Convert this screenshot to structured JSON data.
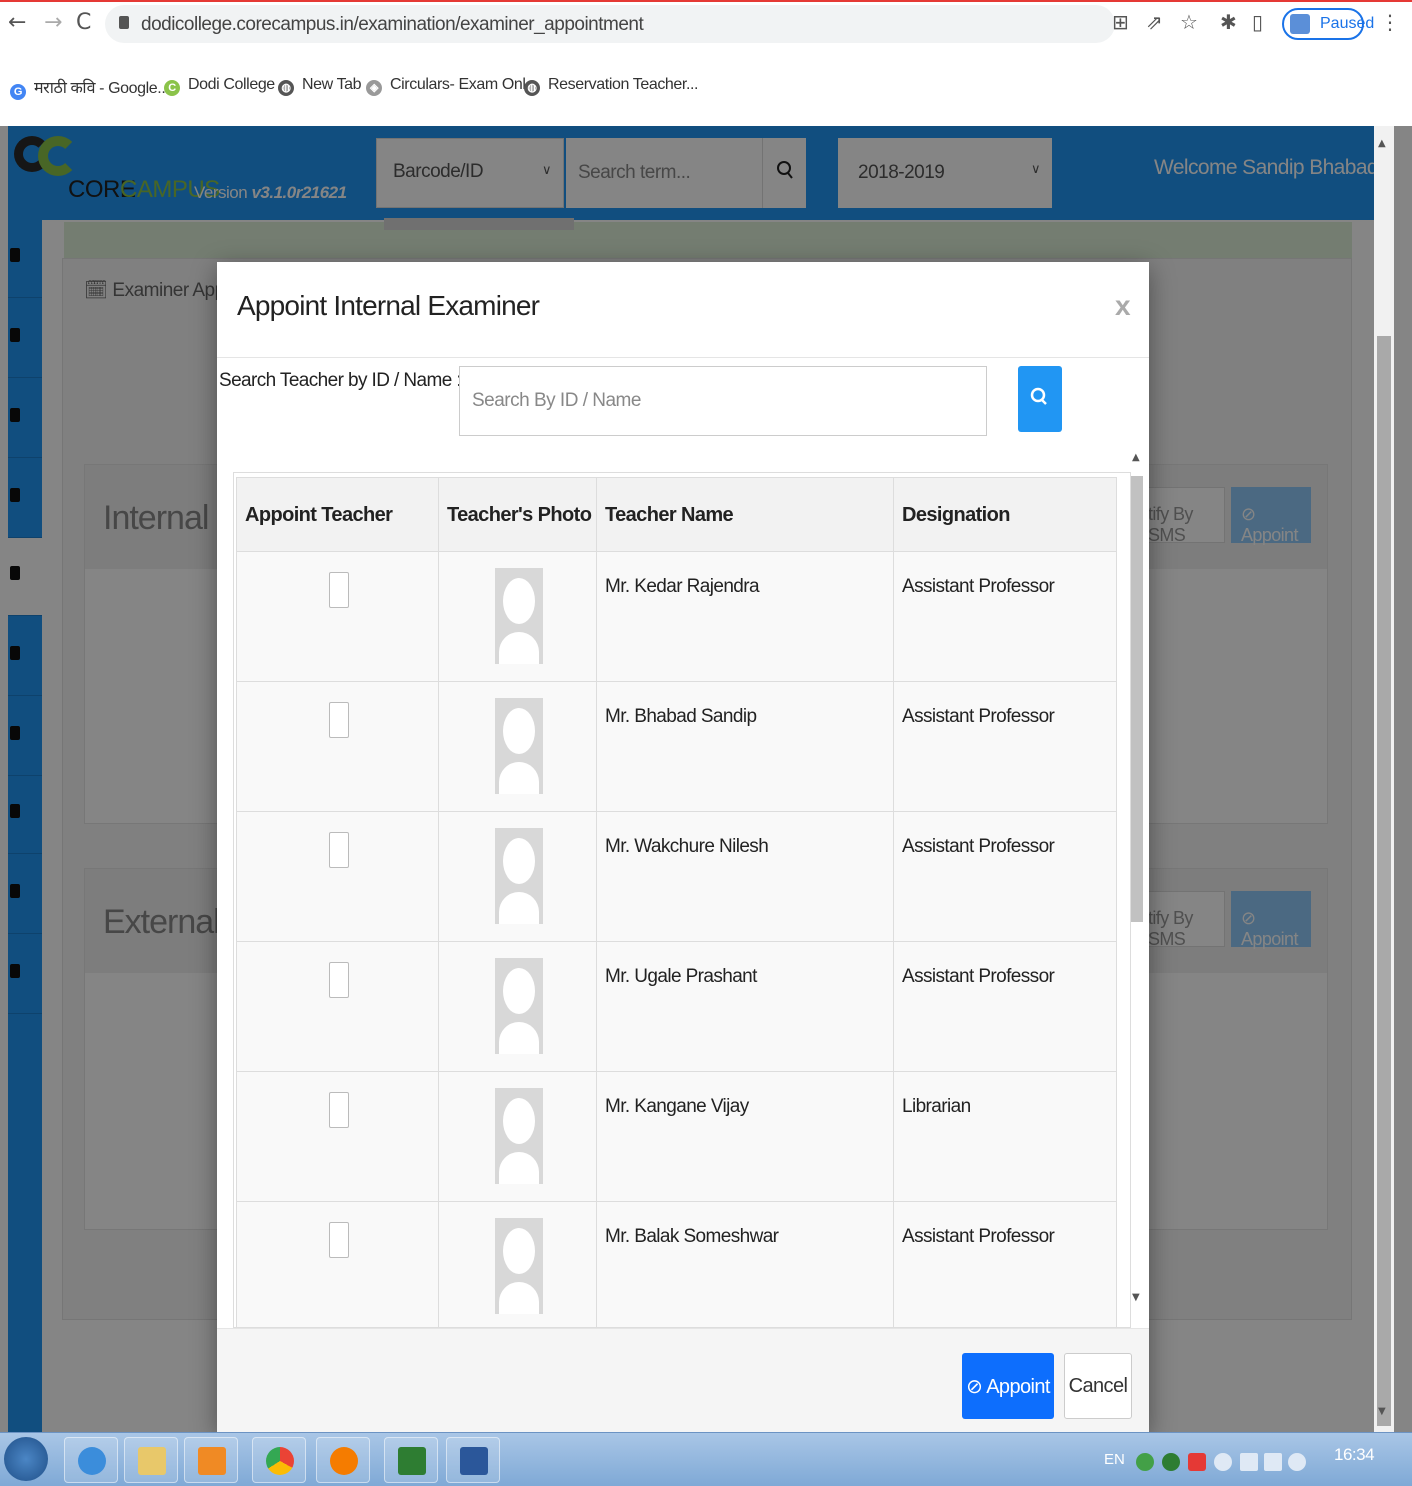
{
  "browser": {
    "url": "dodicollege.corecampus.in/examination/examiner_appointment",
    "profile_label": "Paused",
    "bookmarks": [
      {
        "label": "मराठी कवि - Google...",
        "icon": "google-icon"
      },
      {
        "label": "Dodi College",
        "icon": "corecampus-icon"
      },
      {
        "label": "New Tab",
        "icon": "globe-icon"
      },
      {
        "label": "Circulars- Exam Onl...",
        "icon": "emblem-icon"
      },
      {
        "label": "Reservation Teacher...",
        "icon": "globe-icon"
      }
    ]
  },
  "app": {
    "logo_core": "CORE",
    "logo_campus": "CAMPUS",
    "version_prefix": "Version ",
    "version": "v3.1.0r21621",
    "barcode_select": "Barcode/ID",
    "search_placeholder": "Search term...",
    "year_select": "2018-2019",
    "welcome": "Welcome Sandip Bhabad",
    "accent_color": "#2196f3"
  },
  "background": {
    "tab_label": "Examiner Appo",
    "internal_title": "Internal Exar",
    "external_title": "External Exa",
    "notify_sms": "tify By SMS",
    "appoint": "Appoint"
  },
  "modal": {
    "title": "Appoint Internal Examiner",
    "close": "x",
    "search_label": "Search Teacher by ID / Name :",
    "search_placeholder": "Search By ID / Name",
    "columns": [
      "Appoint Teacher",
      "Teacher's Photo",
      "Teacher Name",
      "Designation"
    ],
    "rows": [
      {
        "name": "Mr. Kedar Rajendra",
        "designation": "Assistant Professor"
      },
      {
        "name": "Mr. Bhabad Sandip",
        "designation": "Assistant Professor"
      },
      {
        "name": "Mr. Wakchure Nilesh",
        "designation": "Assistant Professor"
      },
      {
        "name": "Mr. Ugale Prashant",
        "designation": "Assistant Professor"
      },
      {
        "name": "Mr. Kangane Vijay",
        "designation": "Librarian"
      },
      {
        "name": "Mr. Balak Someshwar",
        "designation": "Assistant Professor"
      }
    ],
    "appoint_button": "Appoint",
    "cancel_button": "Cancel"
  },
  "taskbar": {
    "language": "EN",
    "clock": "16:34"
  }
}
